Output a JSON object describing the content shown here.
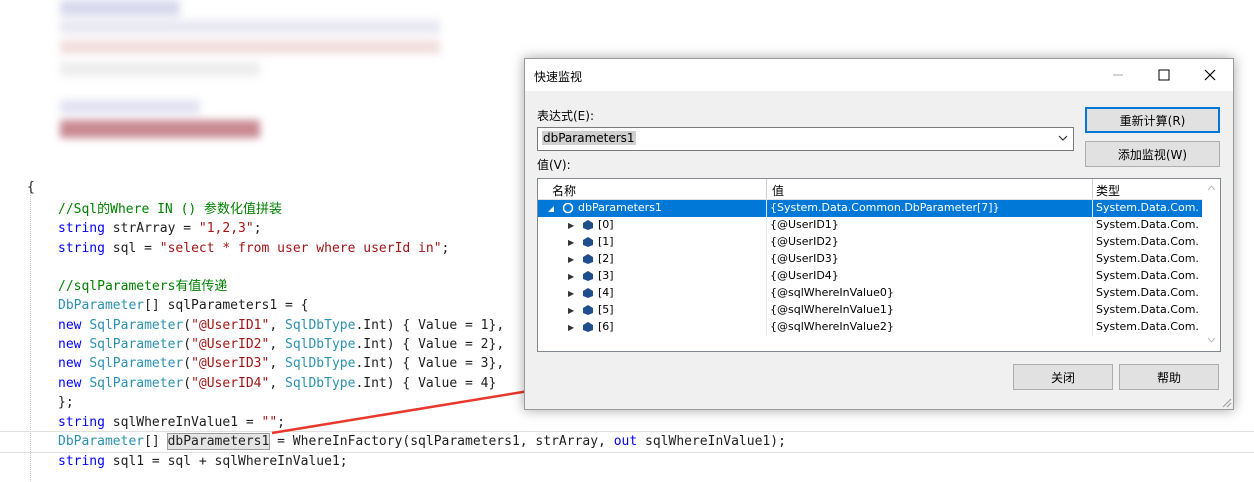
{
  "editor": {
    "open_brace": "{",
    "comment1": "//Sql的Where IN () 参数化值拼装",
    "line_strArray": {
      "kw": "string",
      "rest": " strArray = ",
      "str": "\"1,2,3\"",
      "end": ";"
    },
    "line_sql": {
      "kw": "string",
      "rest": " sql = ",
      "str": "\"select * from user where userId in\"",
      "end": ";"
    },
    "comment2": "//sqlParameters有值传递",
    "line_decl": {
      "type": "DbParameter",
      "rest": "[] sqlParameters1 = {"
    },
    "param_lines": [
      {
        "kw": "new",
        "type1": "SqlParameter",
        "p1": "(",
        "str": "\"@UserID1\"",
        "p2": ", ",
        "type2": "SqlDbType",
        "p3": ".Int) { Value = 1},"
      },
      {
        "kw": "new",
        "type1": "SqlParameter",
        "p1": "(",
        "str": "\"@UserID2\"",
        "p2": ", ",
        "type2": "SqlDbType",
        "p3": ".Int) { Value = 2},"
      },
      {
        "kw": "new",
        "type1": "SqlParameter",
        "p1": "(",
        "str": "\"@UserID3\"",
        "p2": ", ",
        "type2": "SqlDbType",
        "p3": ".Int) { Value = 3},"
      },
      {
        "kw": "new",
        "type1": "SqlParameter",
        "p1": "(",
        "str": "\"@UserID4\"",
        "p2": ", ",
        "type2": "SqlDbType",
        "p3": ".Int) { Value = 4}"
      }
    ],
    "close_array": "};",
    "line_where": {
      "kw": "string",
      "rest": " sqlWhereInValue1 = ",
      "str": "\"\"",
      "end": ";"
    },
    "line_db": {
      "type": "DbParameter",
      "mid": "[] ",
      "hl": "dbParameters1",
      "rest": " = WhereInFactory(sqlParameters1, strArray, ",
      "kw": "out",
      "end": " sqlWhereInValue1);"
    },
    "line_sql1": {
      "kw": "string",
      "rest": " sql1 = sql + sqlWhereInValue1;"
    }
  },
  "dialog": {
    "title": "快速监视",
    "minimize_icon": "minimize-icon",
    "maximize_icon": "maximize-icon",
    "close_icon": "close-icon",
    "expression_label": "表达式(E):",
    "expression_value": "dbParameters1",
    "recalc_button": "重新计算(R)",
    "add_watch_button": "添加监视(W)",
    "value_label": "值(V):",
    "columns": [
      "名称",
      "值",
      "类型"
    ],
    "rows": [
      {
        "expander": "◢",
        "icon": "object-icon",
        "name": "dbParameters1",
        "value": "{System.Data.Common.DbParameter[7]}",
        "type": "System.Data.Com...",
        "selected": true,
        "indent": 0
      },
      {
        "expander": "▶",
        "icon": "field-icon",
        "name": "[0]",
        "value": "{@UserID1}",
        "type": "System.Data.Com...",
        "selected": false,
        "indent": 1
      },
      {
        "expander": "▶",
        "icon": "field-icon",
        "name": "[1]",
        "value": "{@UserID2}",
        "type": "System.Data.Com...",
        "selected": false,
        "indent": 1
      },
      {
        "expander": "▶",
        "icon": "field-icon",
        "name": "[2]",
        "value": "{@UserID3}",
        "type": "System.Data.Com...",
        "selected": false,
        "indent": 1
      },
      {
        "expander": "▶",
        "icon": "field-icon",
        "name": "[3]",
        "value": "{@UserID4}",
        "type": "System.Data.Com...",
        "selected": false,
        "indent": 1
      },
      {
        "expander": "▶",
        "icon": "field-icon",
        "name": "[4]",
        "value": "{@sqlWhereInValue0}",
        "type": "System.Data.Com...",
        "selected": false,
        "indent": 1
      },
      {
        "expander": "▶",
        "icon": "field-icon",
        "name": "[5]",
        "value": "{@sqlWhereInValue1}",
        "type": "System.Data.Com...",
        "selected": false,
        "indent": 1
      },
      {
        "expander": "▶",
        "icon": "field-icon",
        "name": "[6]",
        "value": "{@sqlWhereInValue2}",
        "type": "System.Data.Com...",
        "selected": false,
        "indent": 1
      }
    ],
    "close_button": "关闭",
    "help_button": "帮助"
  },
  "colors": {
    "accent": "#0078d7",
    "keyword": "#0000ff",
    "type": "#2b91af",
    "string": "#a31515",
    "comment": "#008000",
    "arrow": "#e8392c"
  }
}
